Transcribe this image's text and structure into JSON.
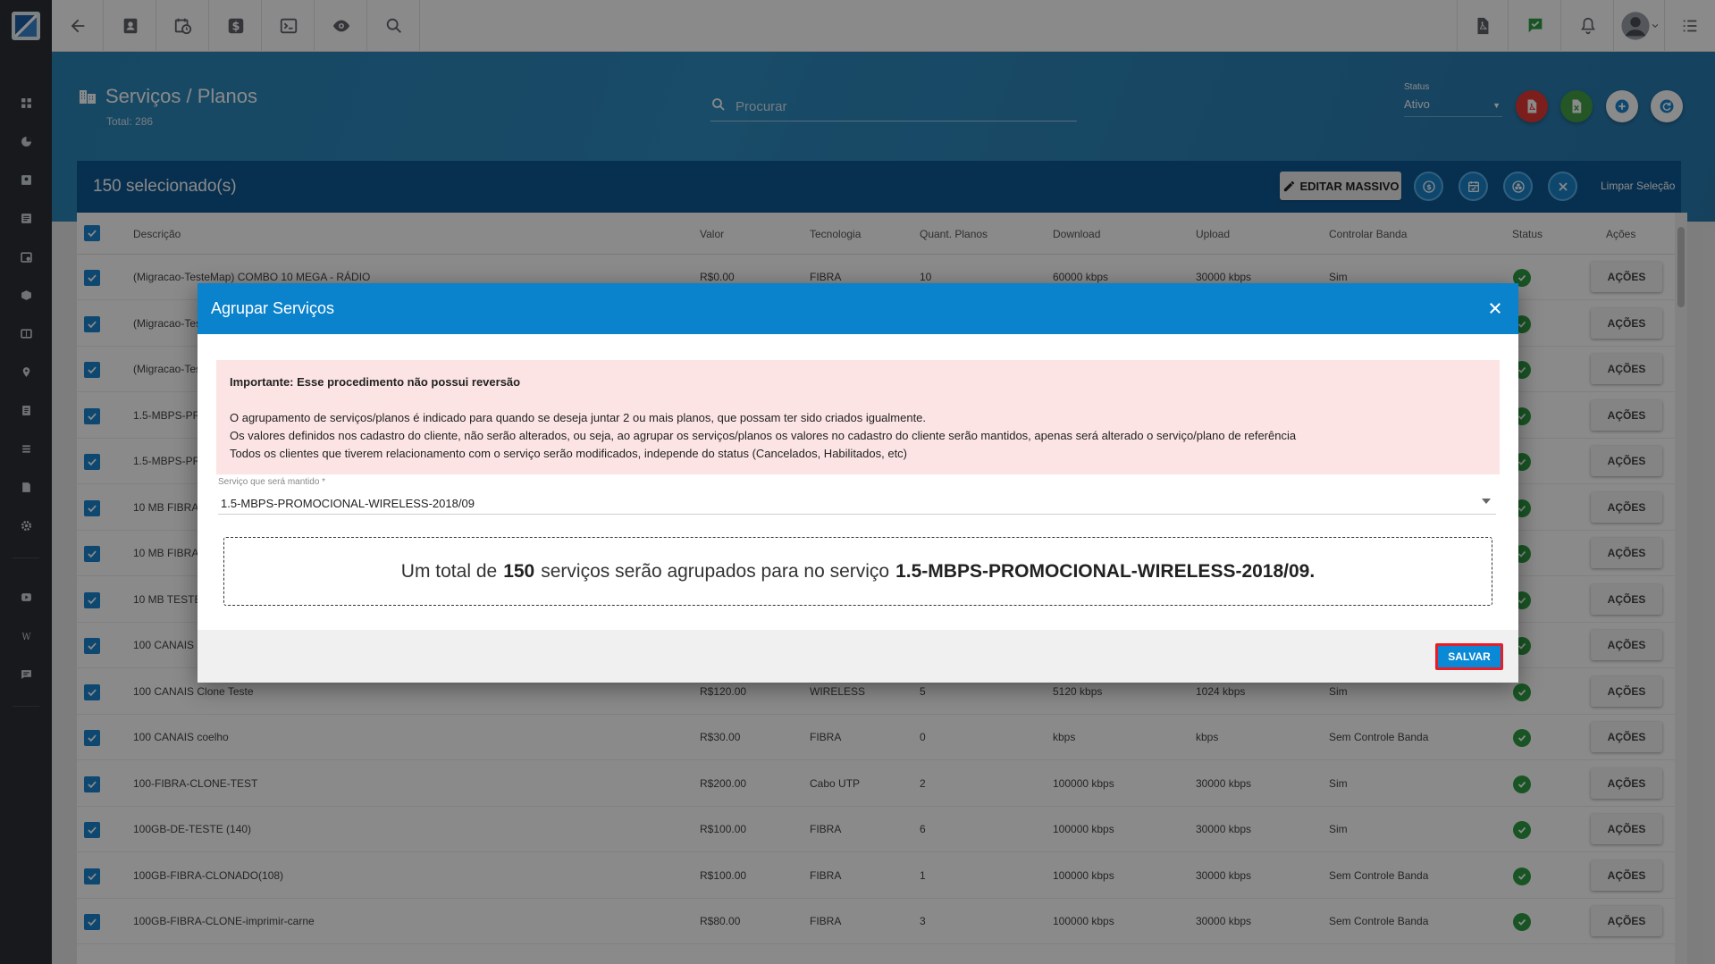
{
  "header": {
    "title": "Serviços / Planos",
    "total": "Total: 286",
    "search_placeholder": "Procurar",
    "status_label": "Status",
    "status_value": "Ativo"
  },
  "selection": {
    "count_text": "150 selecionado(s)",
    "edit_label": "EDITAR MASSIVO",
    "clear_label": "Limpar Seleção"
  },
  "table": {
    "headers": [
      "Descrição",
      "Valor",
      "Tecnologia",
      "Quant. Planos",
      "Download",
      "Upload",
      "Controlar Banda",
      "Status",
      "Ações"
    ],
    "action_label": "AÇÕES",
    "rows": [
      {
        "desc": "(Migracao-TesteMap) COMBO 10 MEGA - RÁDIO",
        "valor": "R$0.00",
        "tec": "FIBRA",
        "qtd": "10",
        "down": "60000 kbps",
        "up": "30000 kbps",
        "banda": "Sim"
      },
      {
        "desc": "(Migracao-Tes",
        "valor": "",
        "tec": "",
        "qtd": "",
        "down": "",
        "up": "",
        "banda": ""
      },
      {
        "desc": "(Migracao-Tes",
        "valor": "",
        "tec": "",
        "qtd": "",
        "down": "",
        "up": "",
        "banda": ""
      },
      {
        "desc": "1.5-MBPS-PRO",
        "valor": "",
        "tec": "",
        "qtd": "",
        "down": "",
        "up": "",
        "banda": ""
      },
      {
        "desc": "1.5-MBPS-PRO",
        "valor": "",
        "tec": "",
        "qtd": "",
        "down": "",
        "up": "",
        "banda": ""
      },
      {
        "desc": "10 MB FIBRA ",
        "valor": "",
        "tec": "",
        "qtd": "",
        "down": "",
        "up": "",
        "banda": ""
      },
      {
        "desc": "10 MB FIBRA ",
        "valor": "",
        "tec": "",
        "qtd": "",
        "down": "",
        "up": "",
        "banda": ""
      },
      {
        "desc": "10 MB TESTE",
        "valor": "",
        "tec": "",
        "qtd": "",
        "down": "",
        "up": "",
        "banda": ""
      },
      {
        "desc": "100 CANAIS",
        "valor": "",
        "tec": "",
        "qtd": "",
        "down": "",
        "up": "",
        "banda": ""
      },
      {
        "desc": "100 CANAIS Clone Teste",
        "valor": "R$120.00",
        "tec": "WIRELESS",
        "qtd": "5",
        "down": "5120 kbps",
        "up": "1024 kbps",
        "banda": "Sim"
      },
      {
        "desc": "100 CANAIS coelho",
        "valor": "R$30.00",
        "tec": "FIBRA",
        "qtd": "0",
        "down": "kbps",
        "up": "kbps",
        "banda": "Sem Controle Banda"
      },
      {
        "desc": "100-FIBRA-CLONE-TEST",
        "valor": "R$200.00",
        "tec": "Cabo UTP",
        "qtd": "2",
        "down": "100000 kbps",
        "up": "30000 kbps",
        "banda": "Sim"
      },
      {
        "desc": "100GB-DE-TESTE (140)",
        "valor": "R$100.00",
        "tec": "FIBRA",
        "qtd": "6",
        "down": "100000 kbps",
        "up": "30000 kbps",
        "banda": "Sim"
      },
      {
        "desc": "100GB-FIBRA-CLONADO(108)",
        "valor": "R$100.00",
        "tec": "FIBRA",
        "qtd": "1",
        "down": "100000 kbps",
        "up": "30000 kbps",
        "banda": "Sem Controle Banda"
      },
      {
        "desc": "100GB-FIBRA-CLONE-imprimir-carne",
        "valor": "R$80.00",
        "tec": "FIBRA",
        "qtd": "3",
        "down": "100000 kbps",
        "up": "30000 kbps",
        "banda": "Sem Controle Banda"
      }
    ]
  },
  "modal": {
    "title": "Agrupar Serviços",
    "alert_title": "Importante: Esse procedimento não possui reversão",
    "alert_lines": [
      "O agrupamento de serviços/planos é indicado para quando se deseja juntar 2 ou mais planos, que possam ter sido criados igualmente.",
      "Os valores definidos nos cadastro do cliente, não serão alterados, ou seja, ao agrupar os serviços/planos os valores no cadastro do cliente serão mantidos, apenas será alterado o serviço/plano de referência",
      "Todos os clientes que tiverem relacionamento com o serviço serão modificados, independe do status (Cancelados, Habilitados, etc)"
    ],
    "keep_label": "Serviço que será mantido *",
    "keep_value": "1.5-MBPS-PROMOCIONAL-WIRELESS-2018/09",
    "summary_pre": "Um total de",
    "summary_count": "150",
    "summary_mid": "serviços serão agrupados para no serviço",
    "summary_target": "1.5-MBPS-PROMOCIONAL-WIRELESS-2018/09.",
    "save_label": "SALVAR"
  },
  "colors": {
    "accent": "#0a82cc",
    "selection_bar": "#0e5a94",
    "header_band": "#2f8cc0",
    "sidebar": "#2b2f36",
    "alert_bg": "#fce4e4",
    "status_ok": "#2f9e44",
    "highlight": "#e61e2a"
  }
}
